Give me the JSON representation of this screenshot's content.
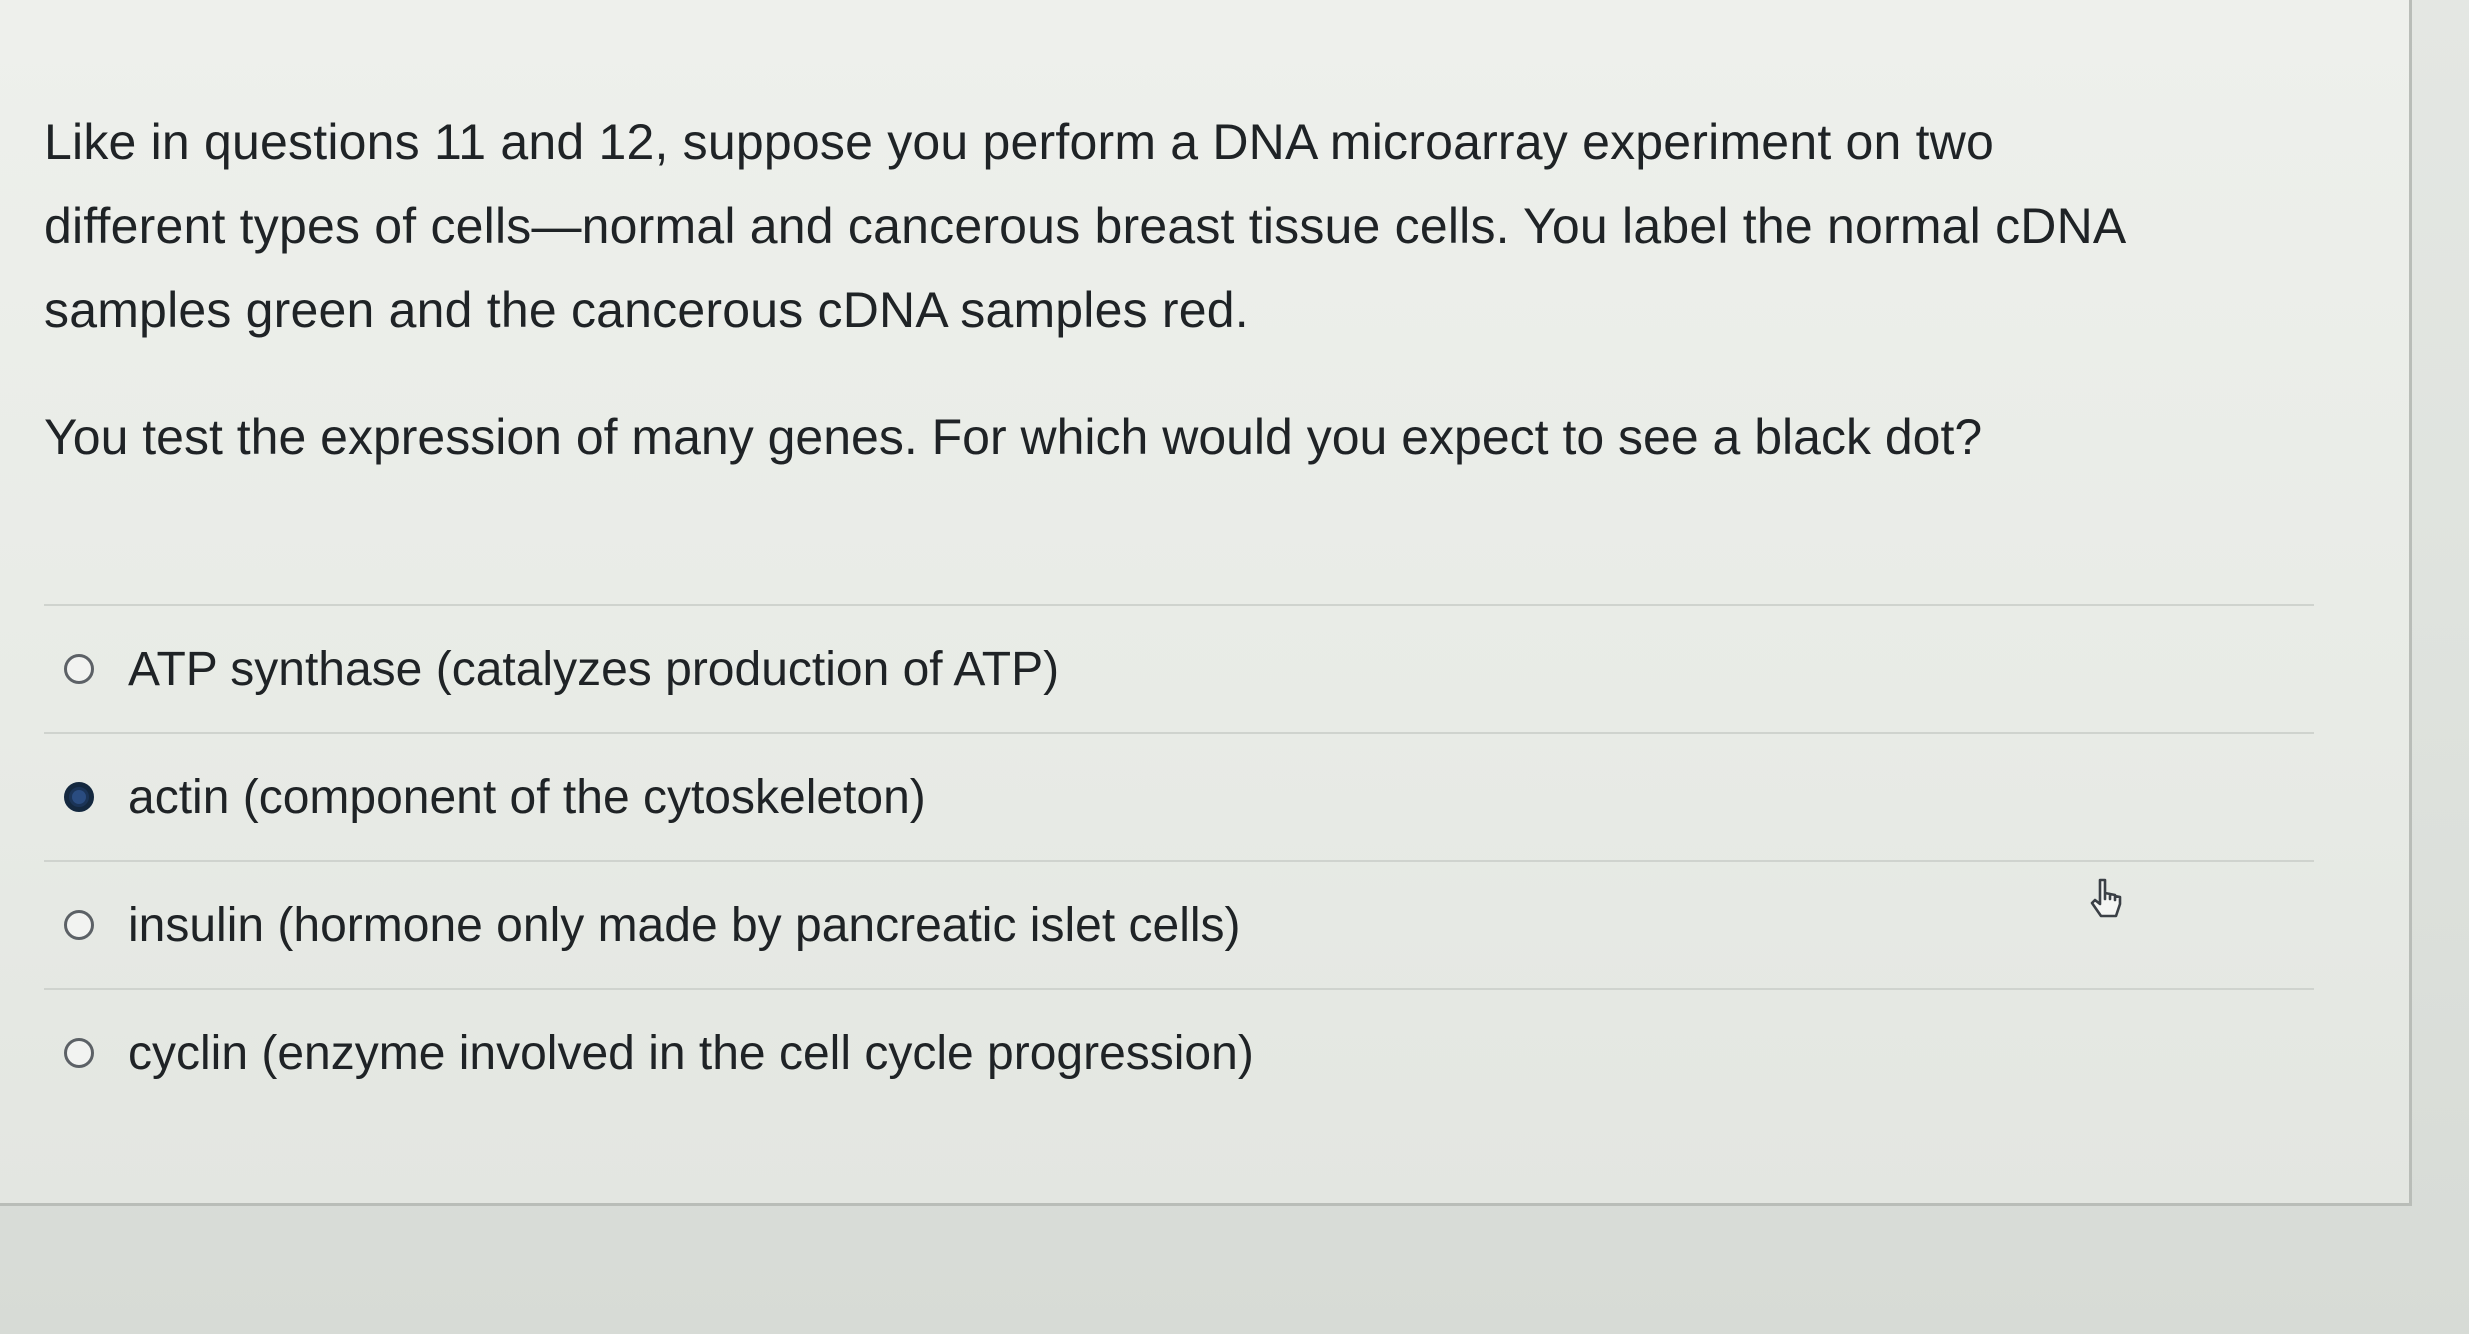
{
  "question": {
    "prompt_lines": [
      "Like in questions 11 and 12,  suppose you perform a DNA microarray experiment on two",
      "different types of cells—normal and cancerous breast tissue cells.  You label the normal cDNA",
      "samples green and the cancerous cDNA samples red."
    ],
    "question_text": "You test the expression of many genes.  For which would you expect to see a black dot?"
  },
  "answers": [
    {
      "label": "ATP synthase (catalyzes production of ATP)",
      "selected": false
    },
    {
      "label": "actin (component of the cytoskeleton)",
      "selected": true
    },
    {
      "label": "insulin (hormone only made by pancreatic islet cells)",
      "selected": false
    },
    {
      "label": "cyclin (enzyme involved in the cell cycle progression)",
      "selected": false
    }
  ],
  "colors": {
    "selected_radio": "#1b3457",
    "text": "#1f2326"
  },
  "icons": {
    "cursor": "pointer-cursor-icon"
  }
}
